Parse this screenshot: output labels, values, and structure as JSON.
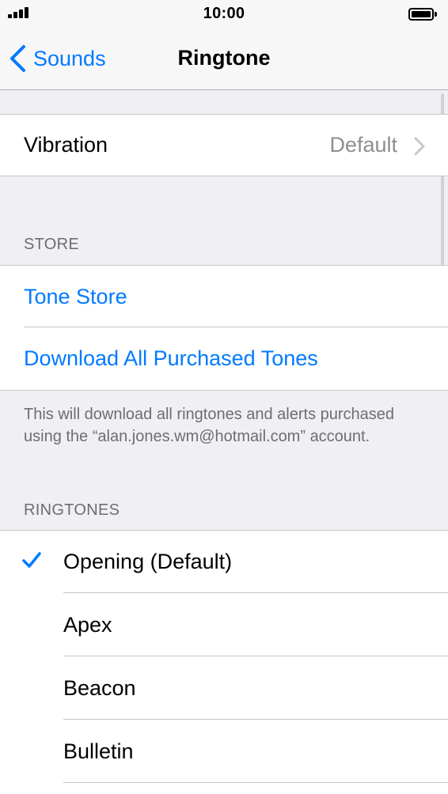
{
  "status_bar": {
    "time": "10:00",
    "signal_icon": "cellular-signal-icon",
    "battery_icon": "battery-full-icon"
  },
  "nav": {
    "back_label": "Sounds",
    "back_icon": "chevron-left-icon",
    "title": "Ringtone",
    "accent_color": "#007aff"
  },
  "vibration": {
    "label": "Vibration",
    "value": "Default",
    "chevron_icon": "chevron-right-icon"
  },
  "store": {
    "header": "STORE",
    "tone_store_label": "Tone Store",
    "download_label": "Download All Purchased Tones",
    "footer": "This will download all ringtones and alerts purchased using the “alan.jones.wm@hotmail.com” account."
  },
  "ringtones": {
    "header": "RINGTONES",
    "selected_icon": "checkmark-icon",
    "items": [
      {
        "label": "Opening (Default)",
        "selected": true
      },
      {
        "label": "Apex",
        "selected": false
      },
      {
        "label": "Beacon",
        "selected": false
      },
      {
        "label": "Bulletin",
        "selected": false
      }
    ]
  }
}
